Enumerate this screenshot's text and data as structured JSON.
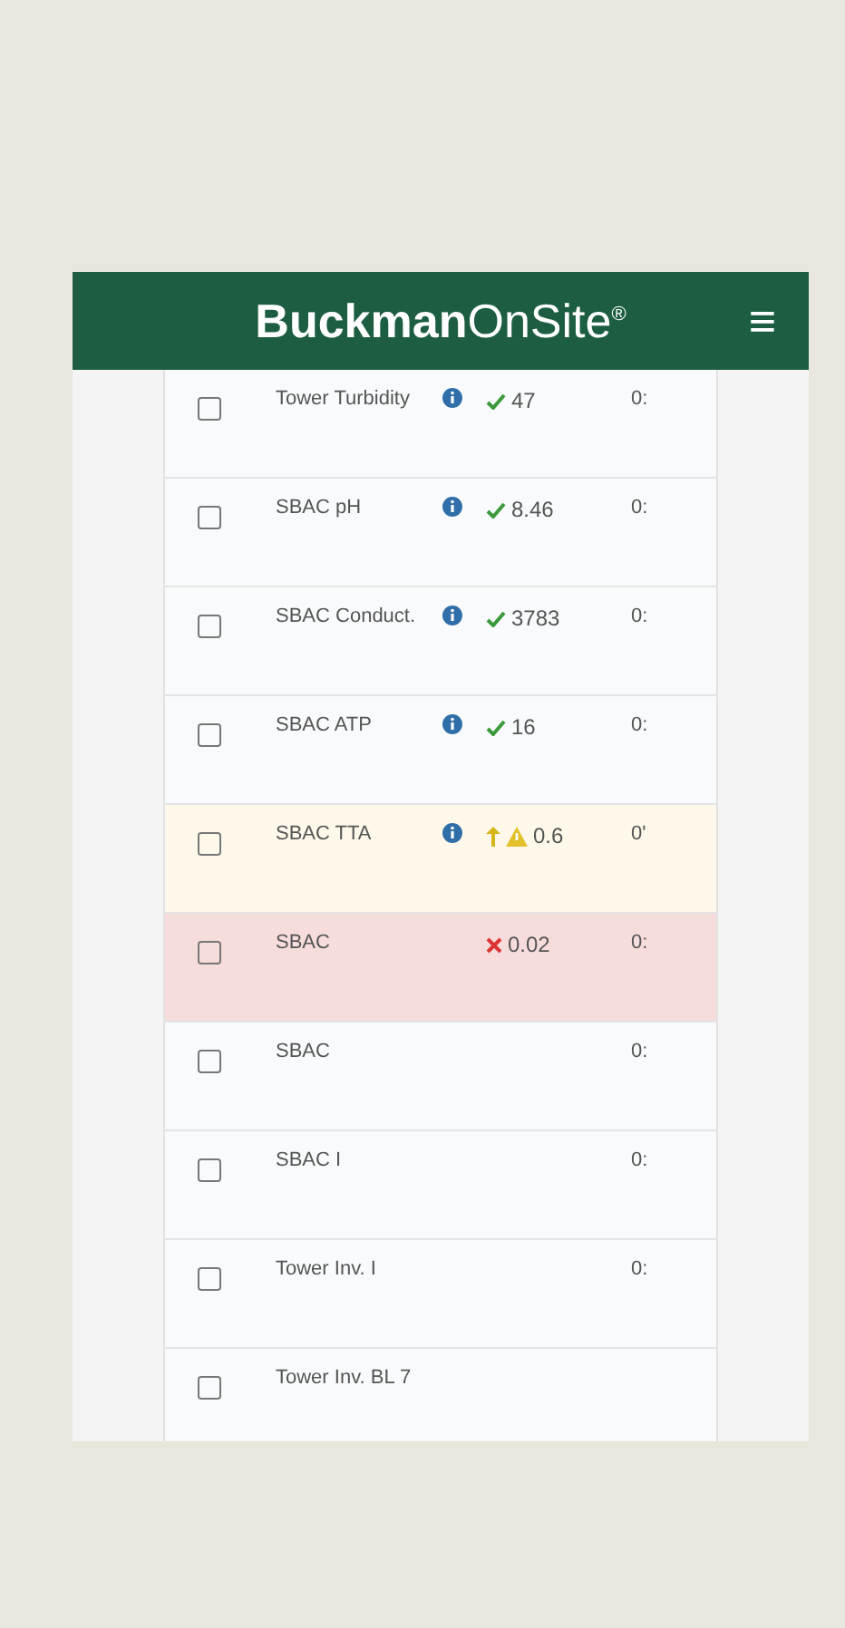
{
  "header": {
    "logo": "**Buckman**OnSite$^{®}$",
    "menu_icon": "≡"
  },
  "rows": [
    {
      "checked": false,
      "name": "Tower Turbidity",
      "info": true,
      "ok": true,
      "rising": false,
      "warning": false,
      "alarm": false,
      "value": "47",
      "column_4": "0:"
    },
    {
      "checked": false,
      "name": "SBAC pH",
      "info": true,
      "ok": true,
      "rising": false,
      "warning": false,
      "alarm": false,
      "value": "8.46",
      "column_4": "0:"
    },
    {
      "checked": false,
      "name": "SBAC Conduct.",
      "info": true,
      "ok": true,
      "rising": false,
      "warning": false,
      "alarm": false,
      "value": "3783",
      "column_4": "0:"
    },
    {
      "checked": false,
      "name": "SBAC ATP",
      "info": true,
      "ok": true,
      "rising": false,
      "warning": false,
      "alarm": false,
      "value": "16",
      "column_4": "0:"
    },
    {
      "checked": false,
      "name": "SBAC TTA",
      "info": true,
      "ok": false,
      "rising": true,
      "warning": true,
      "alarm": false,
      "value": "0.6",
      "column_4": "0'"
    },
    {
      "checked": false,
      "name": "SBAC",
      "ok": false,
      "rising": false,
      "warning": false,
      "alarm": true,
      "value": "0.02",
      "column_4": "0:"
    },
    {
      "checked": false,
      "name": "SBAC",
      "column_4": "0:"
    },
    {
      "checked": false,
      "name": "SBAC I",
      "column_4": "0:"
    },
    {
      "checked": false,
      "name": "Tower Inv. I",
      "column_4": "0:"
    },
    {
      "checked": false,
      "name": "Tower Inv. BL 7"
    }
  ]
}
